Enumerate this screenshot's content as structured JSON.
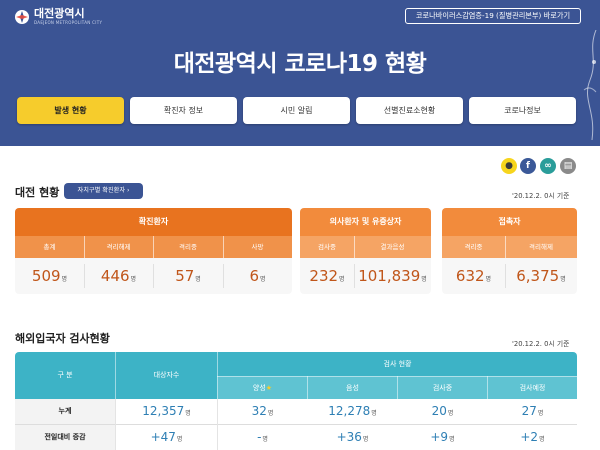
{
  "header": {
    "logo_main": "대전광역시",
    "logo_sub": "DAEJEON METROPOLITAN CITY",
    "external_link": "코로나바이러스감염증-19 (질병관리본부) 바로가기",
    "title": "대전광역시 코로나19 현황"
  },
  "nav": {
    "items": [
      {
        "label": "발생 현황",
        "active": true
      },
      {
        "label": "확진자 정보",
        "active": false
      },
      {
        "label": "시민 알림",
        "active": false
      },
      {
        "label": "선별진료소현황",
        "active": false
      },
      {
        "label": "코로나정보",
        "active": false
      }
    ]
  },
  "share": {
    "icons": [
      "kakaotalk-icon",
      "facebook-icon",
      "link-icon",
      "print-icon"
    ],
    "colors": [
      "#f7d51d",
      "#3b5998",
      "#2a9d9a",
      "#8a8a8a"
    ]
  },
  "status": {
    "title": "대전 현황",
    "button": "자치구별 확진환자",
    "date": "'20.12.2. 0시 기준",
    "unit": "명",
    "confirmed": {
      "head": "확진환자",
      "cols": [
        "총계",
        "격리해제",
        "격리중",
        "사망"
      ],
      "values": [
        "509",
        "446",
        "57",
        "6"
      ]
    },
    "suspected": {
      "head": "의사환자 및 유증상자",
      "cols": [
        "검사중",
        "결과음성"
      ],
      "values": [
        "232",
        "101,839"
      ]
    },
    "contact": {
      "head": "접촉자",
      "cols": [
        "격리중",
        "격리해제"
      ],
      "values": [
        "632",
        "6,375"
      ]
    }
  },
  "overseas": {
    "title": "해외입국자 검사현황",
    "date": "'20.12.2. 0시 기준",
    "headers": {
      "category": "구 분",
      "targets": "대상자수",
      "group": "검사 현황",
      "positive": "양성",
      "negative": "음성",
      "testing": "검사중",
      "scheduled": "검사예정"
    },
    "rows": [
      {
        "label": "누계",
        "values": [
          "12,357",
          "32",
          "12,278",
          "20",
          "27"
        ]
      },
      {
        "label": "전일대비 증감",
        "values": [
          "+47",
          "-",
          "+36",
          "+9",
          "+2"
        ]
      }
    ]
  },
  "colors": {
    "header_bg": "#3b5494",
    "active_nav": "#f6cc2c",
    "confirmed_head": "#e8731f",
    "confirmed_sub": "#f0924a",
    "suspected_head": "#f28b3c",
    "contact_head": "#f28b3c",
    "table_head": "#3db3c6",
    "table_sub": "#5fc3d2"
  }
}
